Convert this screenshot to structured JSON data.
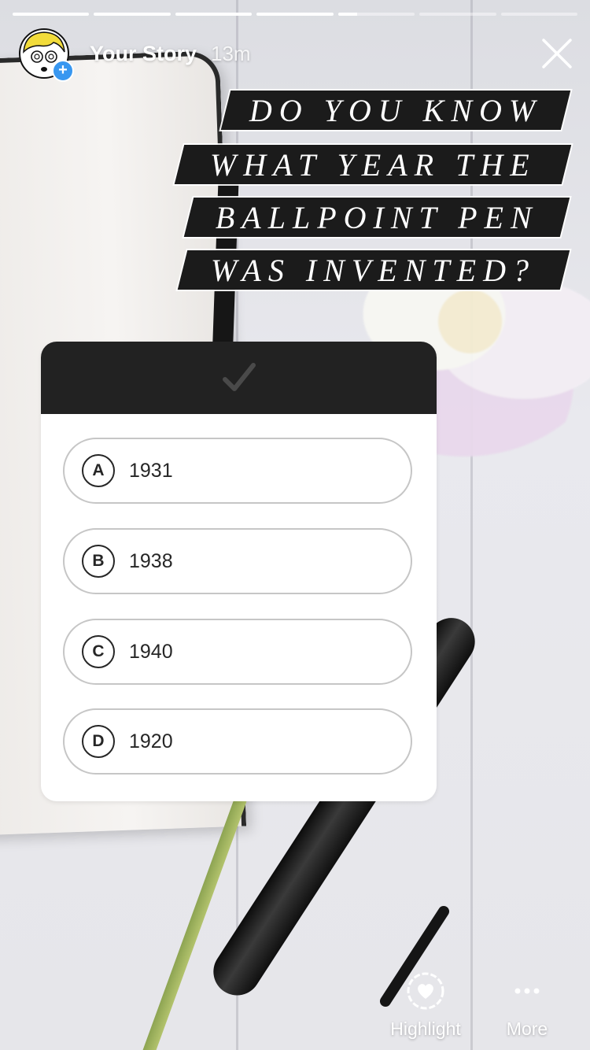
{
  "story": {
    "username": "Your Story",
    "timestamp": "13m",
    "segments": [
      1,
      1,
      1,
      1,
      0.25,
      0,
      0
    ]
  },
  "question": {
    "lines": [
      "DO YOU KNOW",
      "WHAT YEAR THE",
      "BALLPOINT PEN",
      "WAS INVENTED?"
    ]
  },
  "quiz": {
    "header_icon": "checkmark-icon",
    "options": [
      {
        "letter": "A",
        "text": "1931"
      },
      {
        "letter": "B",
        "text": "1938"
      },
      {
        "letter": "C",
        "text": "1940"
      },
      {
        "letter": "D",
        "text": "1920"
      }
    ]
  },
  "actions": {
    "highlight_label": "Highlight",
    "more_label": "More"
  },
  "icons": {
    "close": "close-icon",
    "highlight": "heart-circle-icon",
    "more": "more-dots-icon"
  },
  "colors": {
    "accent": "#3897f0",
    "card_header": "#222222",
    "text_dark": "#262626"
  }
}
